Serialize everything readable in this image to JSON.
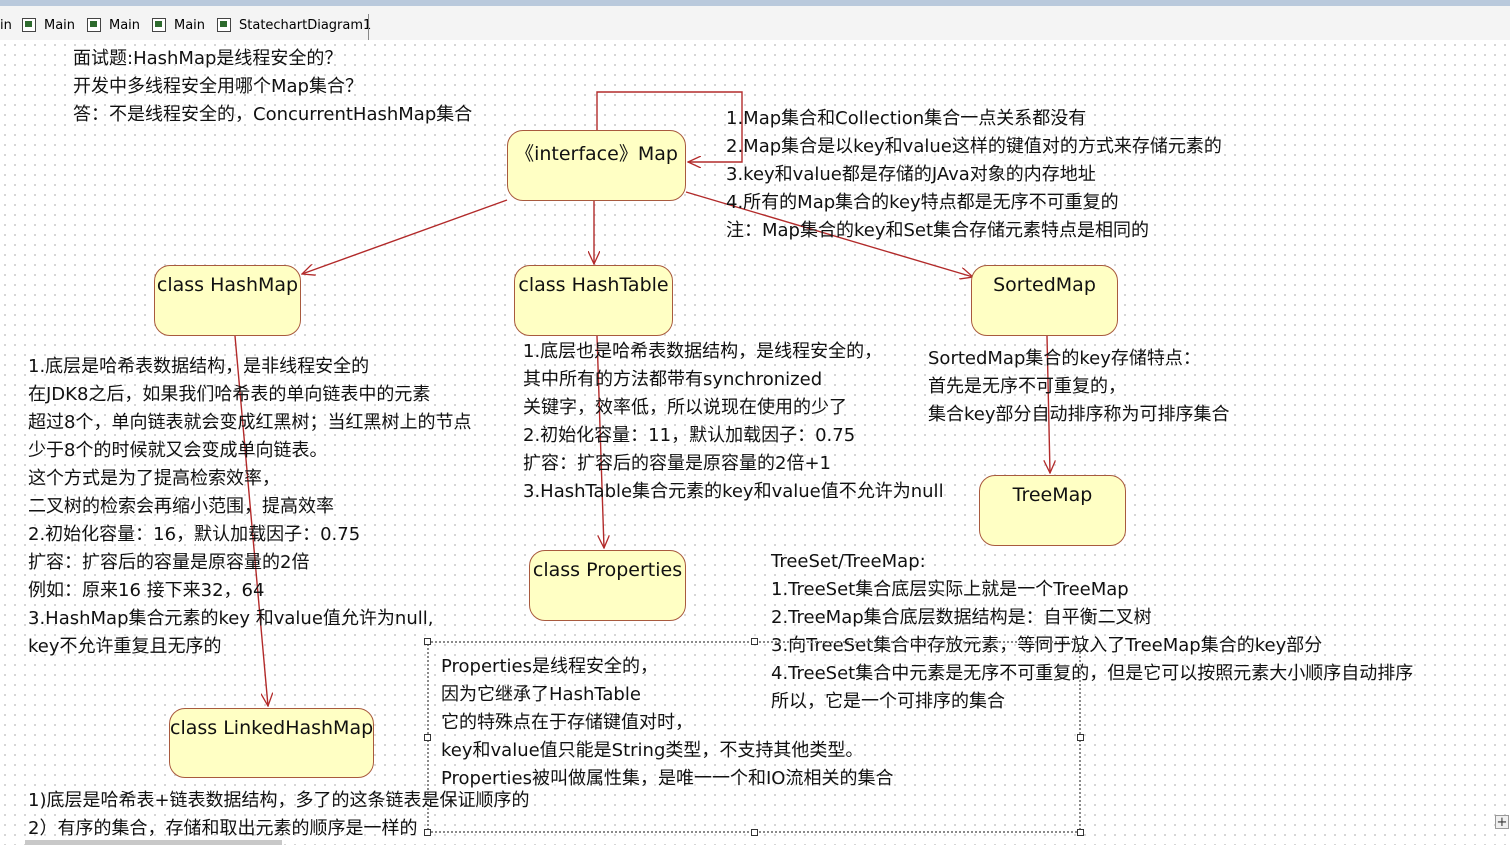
{
  "tabs": [
    {
      "label": "in"
    },
    {
      "label": "Main"
    },
    {
      "label": "Main"
    },
    {
      "label": "Main"
    },
    {
      "label": "StatechartDiagram1"
    }
  ],
  "nodes": {
    "map": "《interface》Map",
    "hashmap": "class HashMap",
    "hashtable": "class HashTable",
    "sortedmap": "SortedMap",
    "treemap": "TreeMap",
    "properties": "class Properties",
    "linkedhashmap": "class LinkedHashMap"
  },
  "notes": {
    "interview": [
      "面试题:HashMap是线程安全的？",
      "开发中多线程安全用哪个Map集合？",
      "答：不是线程安全的，ConcurrentHashMap集合"
    ],
    "map_features": [
      "1.Map集合和Collection集合一点关系都没有",
      "2.Map集合是以key和value这样的键值对的方式来存储元素的",
      "3.key和value都是存储的JAva对象的内存地址",
      "4.所有的Map集合的key特点都是无序不可重复的",
      "注：Map集合的key和Set集合存储元素特点是相同的"
    ],
    "hashmap": [
      "1.底层是哈希表数据结构，是非线程安全的",
      "在JDK8之后，如果我们哈希表的单向链表中的元素",
      "超过8个，单向链表就会变成红黑树；当红黑树上的节点",
      "少于8个的时候就又会变成单向链表。",
      "这个方式是为了提高检索效率，",
      "二叉树的检索会再缩小范围，提高效率",
      "2.初始化容量：16，默认加载因子：0.75",
      "扩容：扩容后的容量是原容量的2倍",
      "例如：原来16 接下来32，64",
      "3.HashMap集合元素的key 和value值允许为null,",
      "key不允许重复且无序的"
    ],
    "hashtable": [
      "1.底层也是哈希表数据结构，是线程安全的，",
      "其中所有的方法都带有synchronized",
      "关键字，效率低，所以说现在使用的少了",
      "2.初始化容量：11，默认加载因子：0.75",
      "扩容：扩容后的容量是原容量的2倍+1",
      "3.HashTable集合元素的key和value值不允许为null"
    ],
    "sortedmap": [
      "SortedMap集合的key存储特点：",
      "首先是无序不可重复的，",
      "集合key部分自动排序称为可排序集合"
    ],
    "treeset": [
      "TreeSet/TreeMap:",
      "1.TreeSet集合底层实际上就是一个TreeMap",
      "2.TreeMap集合底层数据结构是：自平衡二叉树",
      "3.向TreeSet集合中存放元素，等同于放入了TreeMap集合的key部分",
      "4.TreeSet集合中元素是无序不可重复的，但是它可以按照元素大小顺序自动排序",
      "所以，它是一个可排序的集合"
    ],
    "properties": [
      "Properties是线程安全的，",
      "因为它继承了HashTable",
      "它的特殊点在于存储键值对时，",
      "key和value值只能是String类型，不支持其他类型。",
      "Properties被叫做属性集，是唯一一个和IO流相关的集合"
    ],
    "linkedhashmap": [
      "1)底层是哈希表+链表数据结构，多了的这条链表是保证顺序的",
      "2）有序的集合，存储和取出元素的顺序是一样的"
    ]
  },
  "colors": {
    "node_fill": "#ffffc4",
    "node_border": "#a85a3e",
    "edge": "#b22a2a"
  }
}
